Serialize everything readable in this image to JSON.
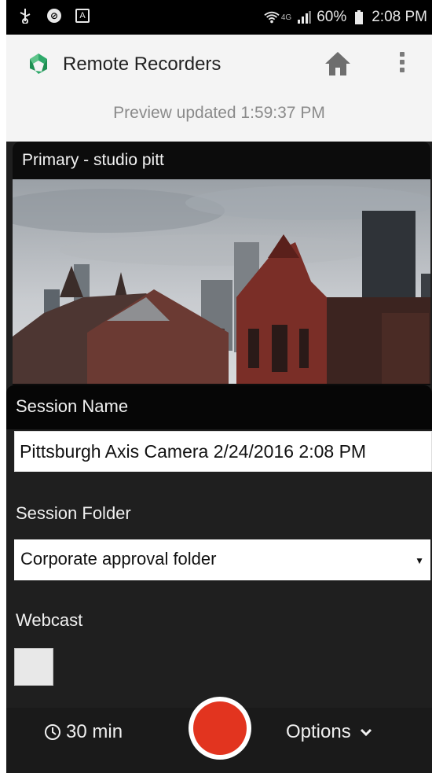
{
  "status_bar": {
    "battery": "60%",
    "time": "2:08 PM",
    "network_label": "4G"
  },
  "app_bar": {
    "title": "Remote Recorders"
  },
  "preview": {
    "text": "Preview updated 1:59:37 PM"
  },
  "camera": {
    "label": "Primary - studio pitt"
  },
  "form": {
    "session_name_label": "Session Name",
    "session_name_value": "Pittsburgh Axis Camera 2/24/2016 2:08 PM",
    "session_folder_label": "Session Folder",
    "session_folder_value": "Corporate approval folder",
    "webcast_label": "Webcast",
    "webcast_checked": false
  },
  "controls": {
    "duration": "30 min",
    "options_label": "Options"
  },
  "colors": {
    "record": "#e2341f",
    "logo_green": "#1e8f52",
    "background": "#1f1f1f"
  },
  "icons": [
    "usb-icon",
    "no-disturb-icon",
    "text-icon",
    "wifi-icon",
    "signal-icon",
    "battery-icon",
    "home-icon",
    "more-vert-icon",
    "clock-icon",
    "chevron-down-icon"
  ]
}
